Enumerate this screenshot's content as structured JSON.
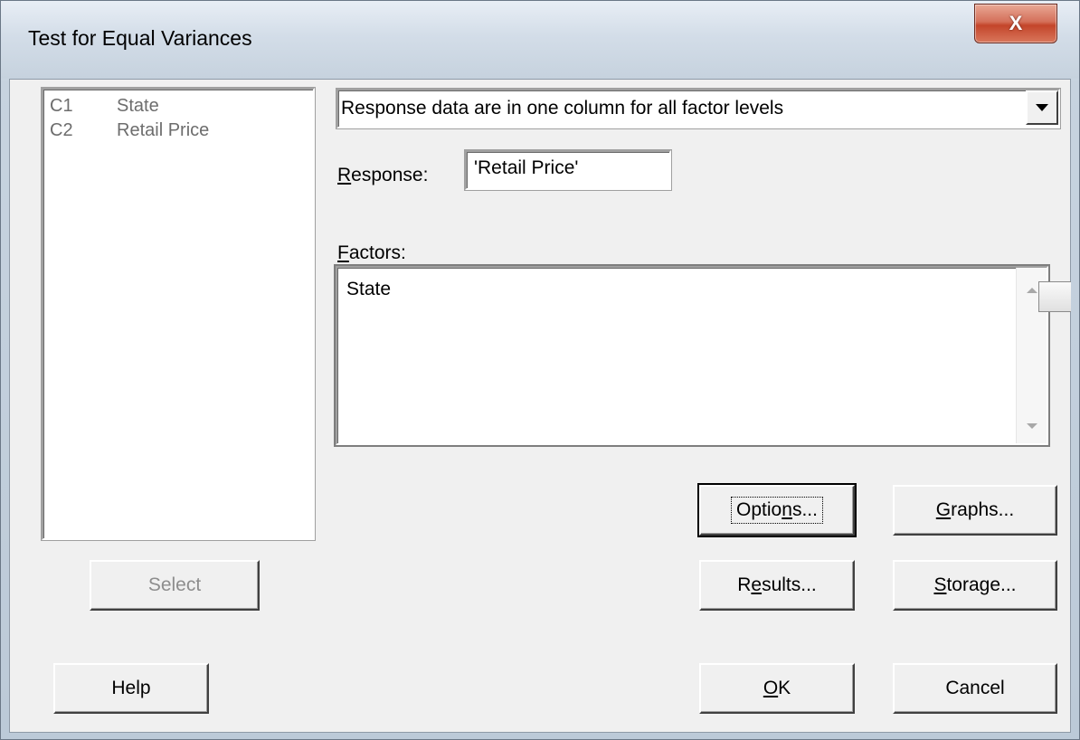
{
  "window": {
    "title": "Test for Equal Variances",
    "close_glyph": "X"
  },
  "variables": [
    {
      "col": "C1",
      "name": "State"
    },
    {
      "col": "C2",
      "name": "Retail Price"
    }
  ],
  "select_button": "Select",
  "help_button": "Help",
  "layout_dropdown": {
    "value": "Response data are in one column for all factor levels"
  },
  "response": {
    "label_first": "R",
    "label_rest": "esponse:",
    "value": "'Retail Price'"
  },
  "factors": {
    "label_first": "F",
    "label_rest": "actors:",
    "value": "State"
  },
  "buttons": {
    "options": {
      "pre": "Optio",
      "u": "n",
      "post": "s..."
    },
    "graphs": {
      "pre": "",
      "u": "G",
      "post": "raphs..."
    },
    "results": {
      "pre": "R",
      "u": "e",
      "post": "sults..."
    },
    "storage": {
      "pre": "",
      "u": "S",
      "post": "torage..."
    },
    "ok": {
      "pre": "",
      "u": "O",
      "post": "K"
    },
    "cancel": "Cancel"
  },
  "icons": {
    "close": "close-icon",
    "dropdown": "chevron-down-icon",
    "scroll_up": "arrow-up-icon",
    "scroll_down": "arrow-down-icon"
  }
}
